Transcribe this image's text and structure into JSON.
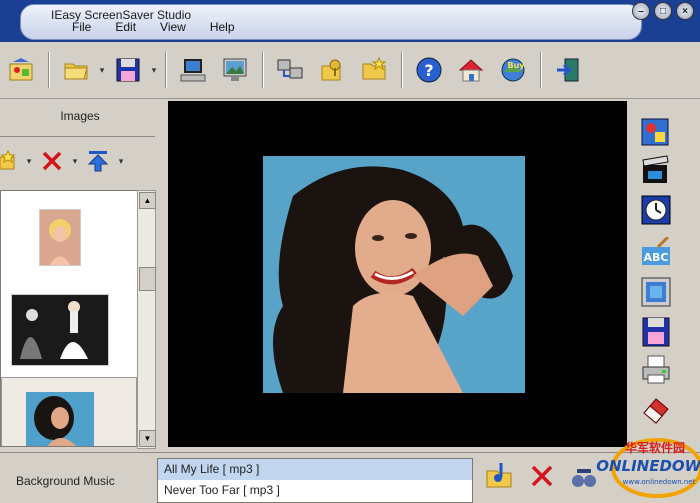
{
  "window": {
    "title": "IEasy ScreenSaver Studio"
  },
  "menu": {
    "items": [
      "File",
      "Edit",
      "View",
      "Help"
    ]
  },
  "window_buttons": [
    "minimize-icon",
    "maximize-icon",
    "close-icon"
  ],
  "toolbar": {
    "buttons": [
      "new-project-icon",
      "open-folder-icon",
      "save-icon",
      "preview-screensaver-icon",
      "display-settings-icon",
      "computer-network-icon",
      "lock-key-icon",
      "folder-star-icon",
      "help-icon",
      "home-icon",
      "buy-icon",
      "exit-icon"
    ]
  },
  "left_panel": {
    "header": "Images",
    "tools": [
      "add-image-icon",
      "delete-icon",
      "move-up-icon"
    ]
  },
  "right_panel": {
    "buttons": [
      "image-settings-icon",
      "clapper-icon",
      "clock-icon",
      "text-abc-icon",
      "background-icon",
      "save-output-icon",
      "printer-icon",
      "eraser-icon"
    ]
  },
  "bottom": {
    "label": "Background Music",
    "music_items": [
      "All My Life [   mp3   ]",
      "Never Too Far [   mp3   ]"
    ],
    "tools": [
      "add-music-icon",
      "delete-music-icon",
      "music-options-icon"
    ]
  },
  "watermark": {
    "brand": "ONLINEDOWN",
    "chinese": "华军软件园",
    "site": "www.onlinedown.net"
  },
  "colors": {
    "titlebar": "#1b3f93",
    "selection": "#c2d6ef",
    "preview_bg": "#000000",
    "photo_bg": "#5aa4c9"
  }
}
